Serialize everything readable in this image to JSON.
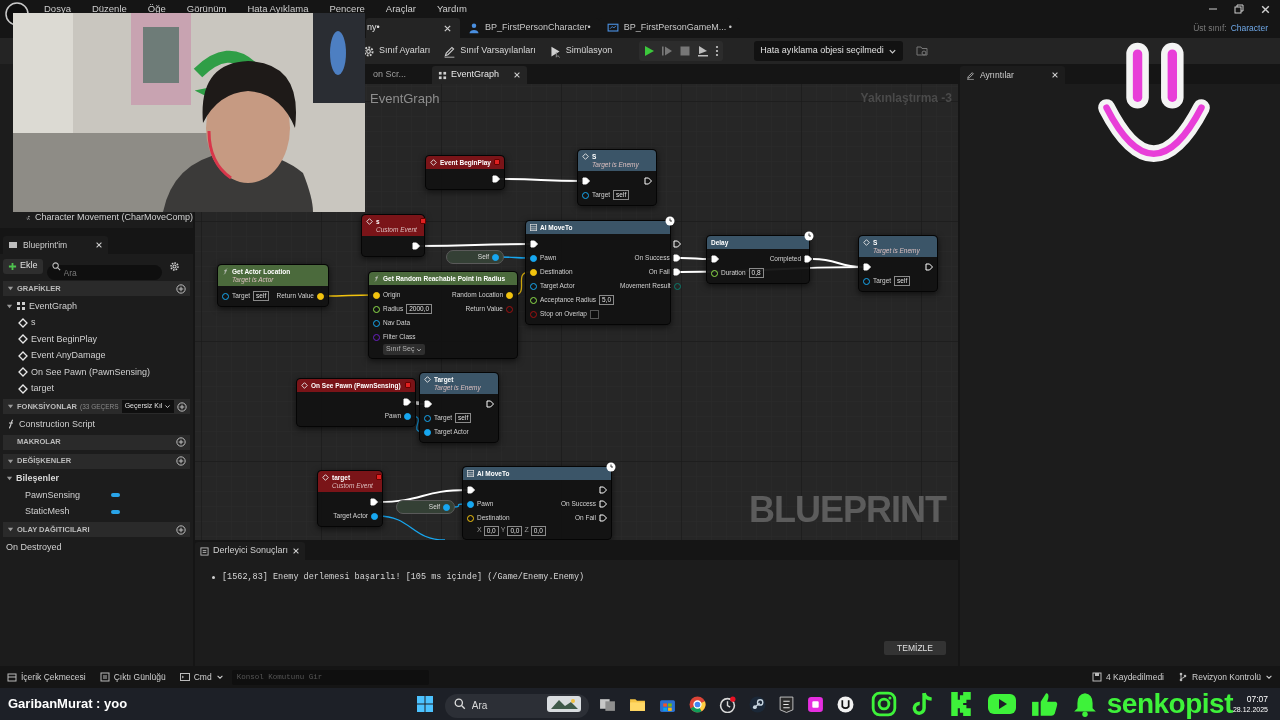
{
  "menu": [
    "Dosya",
    "Düzenle",
    "Öğe",
    "Görünüm",
    "Hata Ayıklama",
    "Pencere",
    "Araçlar",
    "Yardım"
  ],
  "editor_tabs": [
    {
      "label": "ny•",
      "selected": true
    },
    {
      "label": "BP_FirstPersonCharacter•",
      "selected": false
    },
    {
      "label": "BP_FirstPersonGameM... •",
      "selected": false
    }
  ],
  "parent_class": {
    "label": "Üst sınıf:",
    "value": "Character"
  },
  "toolbar": {
    "buttons": [
      {
        "label": "Sınıf Ayarları"
      },
      {
        "label": "Sınıf Varsayılanları"
      },
      {
        "label": "Simülasyon"
      }
    ],
    "debug_dropdown": "Hata ayıklama objesi seçilmedi"
  },
  "components": {
    "visible_item": "Character Movement (CharMoveComp)"
  },
  "my_blueprint": {
    "tab": "Blueprint'im",
    "add_button": "Ekle",
    "search_placeholder": "Ara",
    "sections": [
      {
        "title": "GRAFİKLER",
        "expanded": true,
        "items": [
          {
            "label": "EventGraph",
            "kind": "graph",
            "expanded": true,
            "children": [
              {
                "label": "s",
                "kind": "event"
              },
              {
                "label": "Event BeginPlay",
                "kind": "event"
              },
              {
                "label": "Event AnyDamage",
                "kind": "event"
              },
              {
                "label": "On See Pawn (PawnSensing)",
                "kind": "event"
              },
              {
                "label": "target",
                "kind": "event"
              }
            ]
          }
        ]
      },
      {
        "title": "FONKSİYONLAR",
        "note": "(33 GEÇERS",
        "dropdown": "Geçersiz Kıl",
        "expanded": true,
        "items": [
          {
            "label": "Construction Script",
            "kind": "function"
          }
        ]
      },
      {
        "title": "MAKROLAR"
      },
      {
        "title": "DEĞİŞKENLER",
        "expanded": true,
        "items": [
          {
            "label": "Bileşenler",
            "kind": "category",
            "expanded": true,
            "children": [
              {
                "label": "PawnSensing",
                "kind": "variable"
              },
              {
                "label": "StaticMesh",
                "kind": "variable"
              }
            ]
          }
        ]
      },
      {
        "title": "OLAY DAĞITICILARI",
        "expanded": true,
        "items": [
          {
            "label": "On Destroyed",
            "kind": "dispatcher"
          }
        ]
      }
    ]
  },
  "graph_tabs": [
    {
      "label": "on Scr...",
      "selected": false
    },
    {
      "label": "EventGraph",
      "selected": true
    }
  ],
  "graph": {
    "breadcrumb": "EventGraph",
    "zoom": "Yakınlaştırma -3",
    "watermark": "BLUEPRINT",
    "nodes": [
      {
        "kind": "event",
        "title": "Event BeginPlay",
        "outputs": [
          {
            "kind": "exec",
            "connected": true
          }
        ]
      },
      {
        "kind": "call",
        "title": "S",
        "subtitle": "Target is Enemy",
        "inputs": [
          {
            "kind": "exec",
            "connected": true
          },
          {
            "kind": "object",
            "name": "Target",
            "value": "self",
            "connected": false
          }
        ],
        "outputs": [
          {
            "kind": "exec",
            "connected": false
          }
        ]
      },
      {
        "kind": "event",
        "title": "s",
        "subtitle": "Custom Event",
        "outputs": [
          {
            "kind": "exec",
            "connected": true
          }
        ]
      },
      {
        "kind": "variable",
        "title": "Self",
        "outputs": [
          {
            "kind": "object",
            "connected": true
          }
        ]
      },
      {
        "kind": "call",
        "title": "AI MoveTo",
        "latent": true,
        "inputs": [
          {
            "kind": "exec",
            "connected": true
          },
          {
            "kind": "object",
            "name": "Pawn",
            "connected": true
          },
          {
            "kind": "vector",
            "name": "Destination",
            "connected": true
          },
          {
            "kind": "object",
            "name": "Target Actor",
            "connected": false
          },
          {
            "kind": "float",
            "name": "Acceptance Radius",
            "value": "5,0",
            "connected": false
          },
          {
            "kind": "bool",
            "name": "Stop on Overlap",
            "checked": false,
            "connected": false
          }
        ],
        "outputs": [
          {
            "kind": "exec",
            "connected": false
          },
          {
            "kind": "exec",
            "name": "On Success",
            "connected": true
          },
          {
            "kind": "exec",
            "name": "On Fail",
            "connected": true
          },
          {
            "kind": "byte",
            "name": "Movement Result",
            "connected": false
          }
        ]
      },
      {
        "kind": "call",
        "title": "Delay",
        "latent": true,
        "inputs": [
          {
            "kind": "exec",
            "connected": true
          },
          {
            "kind": "float",
            "name": "Duration",
            "value": "0,8",
            "connected": false
          }
        ],
        "outputs": [
          {
            "kind": "exec",
            "name": "Completed",
            "connected": true
          }
        ]
      },
      {
        "kind": "call",
        "title": "S",
        "subtitle": "Target is Enemy",
        "inputs": [
          {
            "kind": "exec",
            "connected": true
          },
          {
            "kind": "object",
            "name": "Target",
            "value": "self",
            "connected": false
          }
        ],
        "outputs": [
          {
            "kind": "exec",
            "connected": false
          }
        ]
      },
      {
        "kind": "pure",
        "title": "Get Actor Location",
        "subtitle": "Target is Actor",
        "inputs": [
          {
            "kind": "object",
            "name": "Target",
            "value": "self",
            "connected": false
          }
        ],
        "outputs": [
          {
            "kind": "vector",
            "name": "Return Value",
            "connected": true
          }
        ]
      },
      {
        "kind": "pure",
        "title": "Get Random Reachable Point in Radius",
        "inputs": [
          {
            "kind": "vector",
            "name": "Origin",
            "connected": true
          },
          {
            "kind": "float",
            "name": "Radius",
            "value": "2000,0",
            "connected": false
          },
          {
            "kind": "object",
            "name": "Nav Data",
            "connected": false
          },
          {
            "kind": "class",
            "name": "Filter Class",
            "dropdown": "Sınıf Seç",
            "connected": false
          }
        ],
        "outputs": [
          {
            "kind": "vector",
            "name": "Random Location",
            "connected": true
          },
          {
            "kind": "bool",
            "name": "Return Value",
            "connected": false
          }
        ]
      },
      {
        "kind": "event",
        "title": "On See Pawn (PawnSensing)",
        "outputs": [
          {
            "kind": "exec",
            "connected": true
          },
          {
            "kind": "object",
            "name": "Pawn",
            "connected": true
          }
        ]
      },
      {
        "kind": "call",
        "title": "Target",
        "subtitle": "Target is Enemy",
        "inputs": [
          {
            "kind": "exec",
            "connected": true
          },
          {
            "kind": "object",
            "name": "Target",
            "value": "self",
            "connected": false
          },
          {
            "kind": "object",
            "name": "Target Actor",
            "connected": true
          }
        ],
        "outputs": [
          {
            "kind": "exec",
            "connected": false
          }
        ]
      },
      {
        "kind": "event",
        "title": "target",
        "subtitle": "Custom Event",
        "outputs": [
          {
            "kind": "exec",
            "connected": true
          },
          {
            "kind": "object",
            "name": "Target Actor",
            "connected": true
          }
        ]
      },
      {
        "kind": "variable",
        "title": "Self",
        "outputs": [
          {
            "kind": "object",
            "connected": true
          }
        ]
      },
      {
        "kind": "call",
        "title": "AI MoveTo",
        "latent": true,
        "inputs": [
          {
            "kind": "exec",
            "connected": true
          },
          {
            "kind": "object",
            "name": "Pawn",
            "connected": true
          },
          {
            "kind": "vector",
            "name": "Destination",
            "components": [
              {
                "axis": "X",
                "value": "0,0"
              },
              {
                "axis": "Y",
                "value": "0,0"
              },
              {
                "axis": "Z",
                "value": "0,0"
              }
            ],
            "connected": false
          }
        ],
        "outputs": [
          {
            "kind": "exec",
            "connected": false
          },
          {
            "kind": "exec",
            "name": "On Success",
            "connected": false
          },
          {
            "kind": "exec",
            "name": "On Fail",
            "connected": false
          }
        ]
      }
    ]
  },
  "compiler_results": {
    "tab": "Derleyici Sonuçları",
    "messages": [
      "[1562,83] Enemy derlemesi başarılı! [105 ms içinde] (/Game/Enemy.Enemy)"
    ],
    "clear_button": "TEMİZLE"
  },
  "details_panel": {
    "tab": "Ayrıntılar"
  },
  "status_bar": {
    "content_drawer": "İçerik Çekmecesi",
    "output_log": "Çıktı Günlüğü",
    "cmd": "Cmd",
    "console_placeholder": "Konsol Komutunu Gir",
    "unsaved": "4 Kaydedilmedi",
    "revision_control": "Revizyon Kontrolü"
  },
  "stream_overlay": {
    "chat": "GaribanMurat : yoo",
    "handle": "senkopist"
  },
  "taskbar": {
    "search_placeholder": "Ara",
    "time": "07:07",
    "date": "28.12.2025"
  }
}
